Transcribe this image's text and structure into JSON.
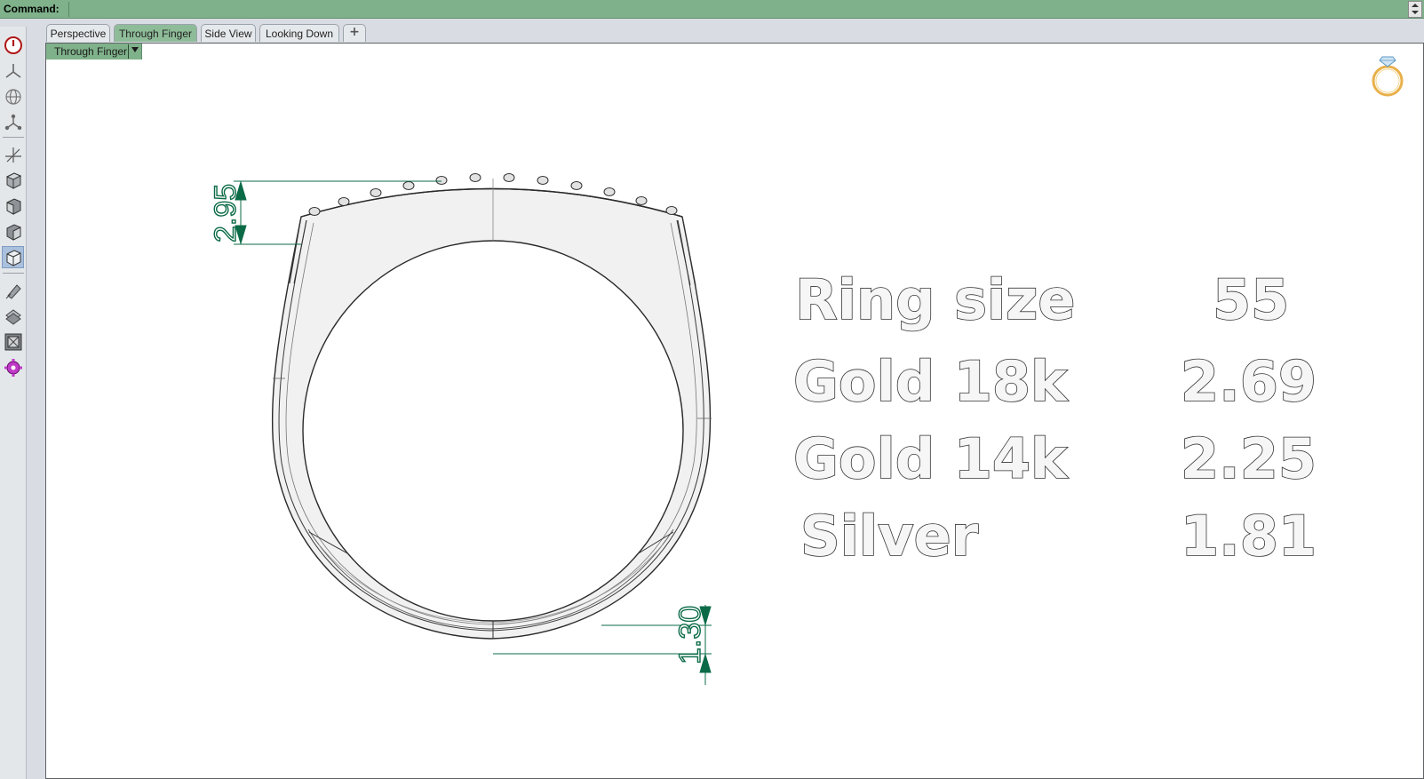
{
  "command_bar": {
    "label": "Command:",
    "value": ""
  },
  "toolbar": {
    "items": [
      {
        "icon": "power-icon"
      },
      {
        "icon": "tripod-icon"
      },
      {
        "icon": "globe-icon"
      },
      {
        "icon": "nodes-icon"
      },
      {
        "icon": "axis-icon"
      },
      {
        "icon": "cube-top-icon"
      },
      {
        "icon": "cube-front-icon"
      },
      {
        "icon": "cube-side-icon"
      },
      {
        "icon": "cube-wire-icon"
      },
      {
        "icon": "pen-icon"
      },
      {
        "icon": "layers-icon"
      },
      {
        "icon": "frame-icon"
      },
      {
        "icon": "gear-icon"
      }
    ]
  },
  "tabs": [
    {
      "label": "Perspective",
      "active": false
    },
    {
      "label": "Through Finger",
      "active": true
    },
    {
      "label": "Side View",
      "active": false
    },
    {
      "label": "Looking Down",
      "active": false
    },
    {
      "label": "+",
      "active": false
    }
  ],
  "viewport": {
    "label": "Through Finger",
    "dimension_top": "2.95",
    "dimension_bottom": "1.30",
    "specs": [
      {
        "label": "Ring size",
        "value": "55"
      },
      {
        "label": "Gold 18k",
        "value": "2.69"
      },
      {
        "label": "Gold 14k",
        "value": "2.25"
      },
      {
        "label": "Silver",
        "value": "1.81"
      }
    ],
    "logo_icon": "ring-logo-icon"
  },
  "colors": {
    "command_bar": "#7fb18a",
    "active_tab": "#8ebc98",
    "dimension": "#0b6b47",
    "logo_gold": "#e8b04a",
    "logo_diamond": "#7fb4d8"
  }
}
